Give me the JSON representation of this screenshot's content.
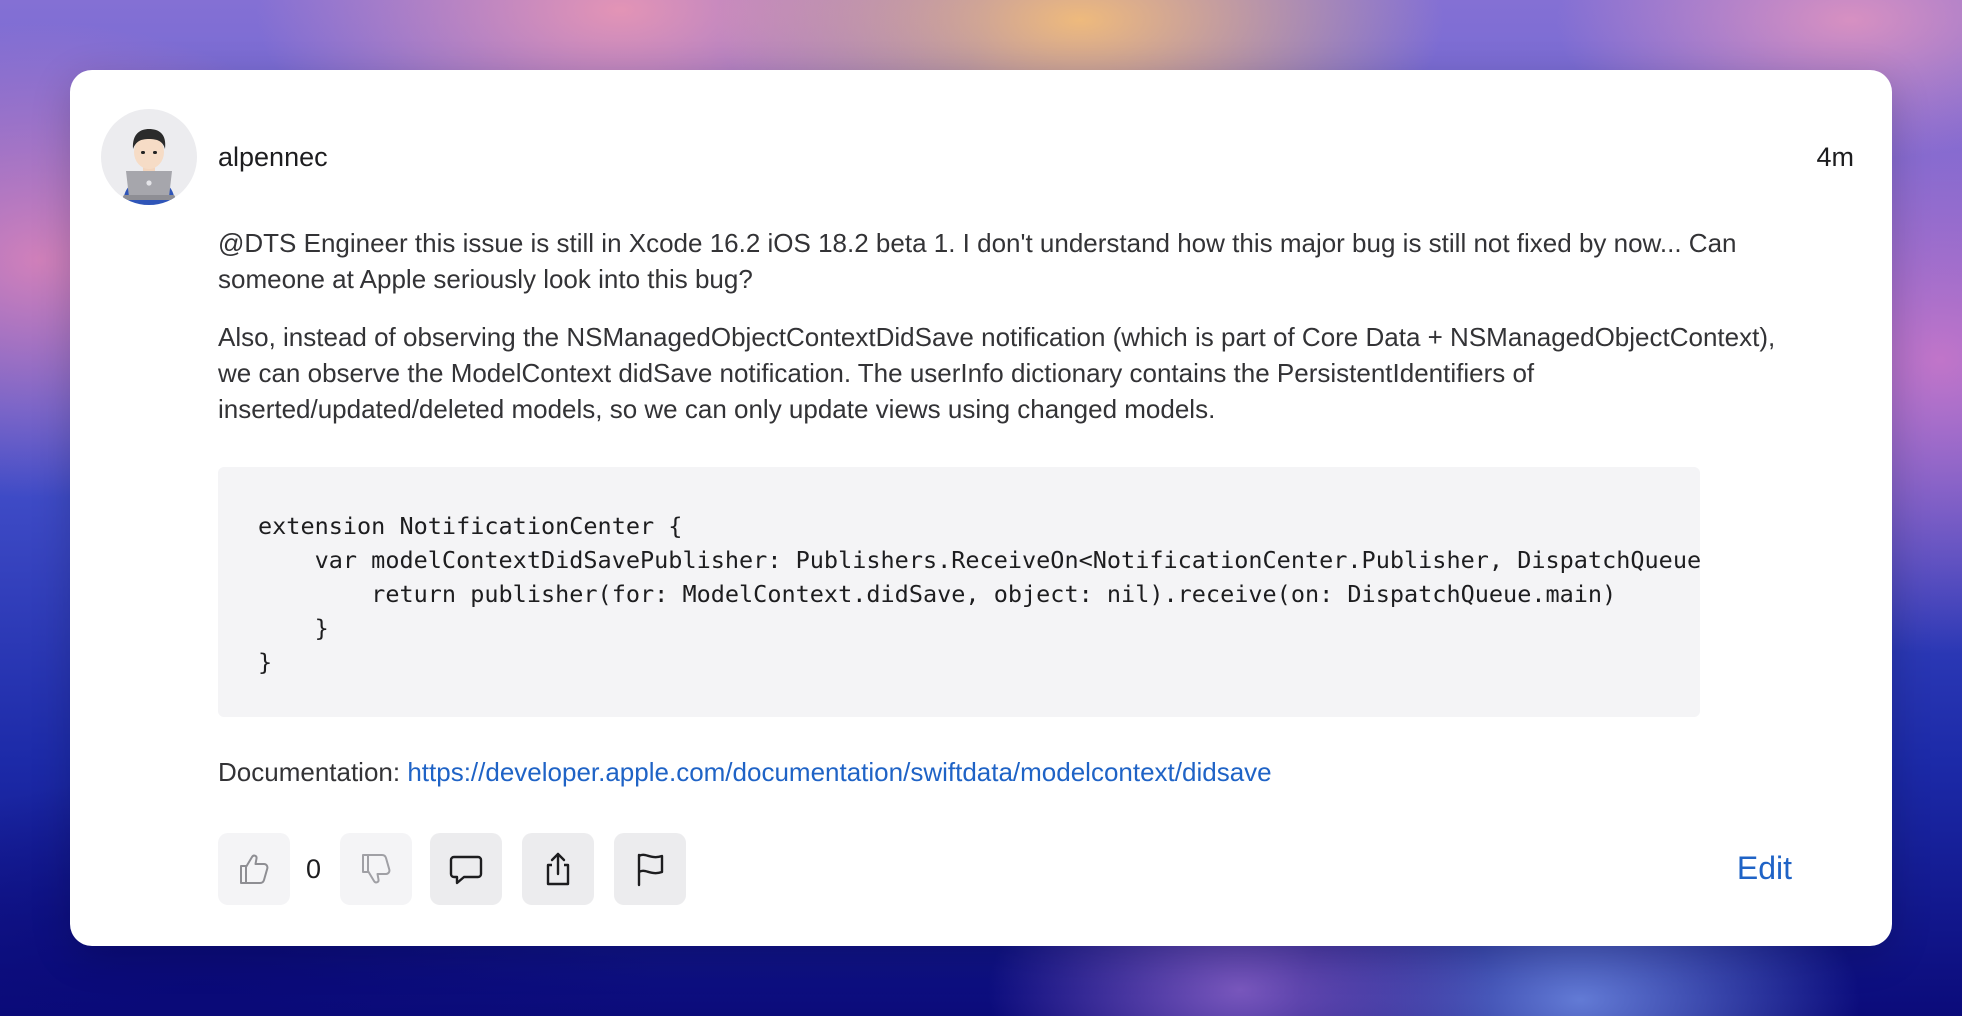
{
  "post": {
    "username": "alpennec",
    "timestamp": "4m",
    "avatar_icon": "technologist-emoji",
    "paragraph1": "@DTS Engineer this issue is still in Xcode 16.2 iOS 18.2 beta 1. I don't understand how this major bug is still not fixed by now... Can someone at Apple seriously look into this bug?",
    "paragraph2": "Also, instead of observing the NSManagedObjectContextDidSave notification (which is part of Core Data + NSManagedObjectContext), we can observe the ModelContext didSave notification. The userInfo dictionary contains the PersistentIdentifiers of inserted/updated/deleted models, so we can only update views using changed models.",
    "code": [
      "extension NotificationCenter {",
      "    var modelContextDidSavePublisher: Publishers.ReceiveOn<NotificationCenter.Publisher, DispatchQueue> {",
      "        return publisher(for: ModelContext.didSave, object: nil).receive(on: DispatchQueue.main)",
      "    }",
      "}"
    ],
    "documentation_label": "Documentation: ",
    "documentation_url": "https://developer.apple.com/documentation/swiftdata/modelcontext/didsave"
  },
  "actions": {
    "vote_count": "0",
    "upvote_icon": "thumbs-up-icon",
    "downvote_icon": "thumbs-down-icon",
    "comment_icon": "comment-icon",
    "share_icon": "share-icon",
    "flag_icon": "flag-icon",
    "edit_label": "Edit"
  },
  "colors": {
    "link": "#1f63c6",
    "text": "#333336",
    "code_background": "#f4f4f6"
  }
}
